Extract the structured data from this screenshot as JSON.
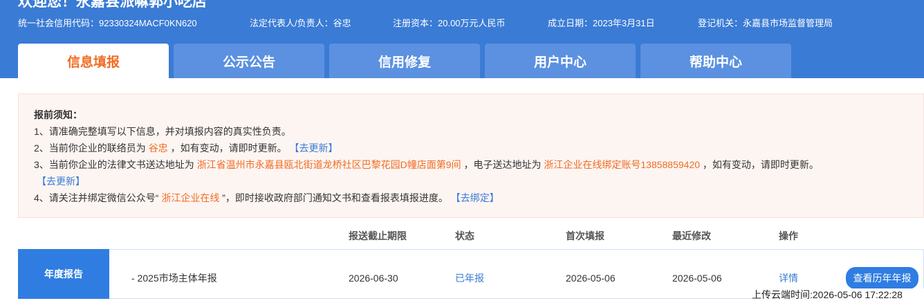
{
  "header": {
    "company_title": "欢迎您！永嘉县派嘛郭小吃店",
    "credit_code": "统一社会信用代码：92330324MACF0KN620",
    "legal_rep": "法定代表人/负责人：谷忠",
    "capital": "注册资本：20.00万元人民币",
    "established": "成立日期：2023年3月31日",
    "authority": "登记机关：永嘉县市场监督管理局"
  },
  "tabs": [
    {
      "label": "信息填报",
      "active": true
    },
    {
      "label": "公示公告",
      "active": false
    },
    {
      "label": "信用修复",
      "active": false
    },
    {
      "label": "用户中心",
      "active": false
    },
    {
      "label": "帮助中心",
      "active": false
    }
  ],
  "notice": {
    "title": "报前须知：",
    "line1": "1、请准确完整填写以下信息，并对填报内容的真实性负责。",
    "line2_prefix": "2、当前你企业的联络员为",
    "line2_contact": "谷忠",
    "line2_mid": "，如有变动，请即时更新。",
    "line2_link": "【去更新】",
    "line3_prefix": "3、当前你企业的法律文书送达地址为",
    "line3_address": "浙江省温州市永嘉县瓯北街道龙桥社区巴黎花园D幢店面第9间",
    "line3_mid": "，电子送达地址为",
    "line3_email": "浙江企业在线绑定账号13858859420",
    "line3_suffix": "，如有变动，请即时更新。",
    "line3_link": "【去更新】",
    "line4_prefix": "4、请关注并绑定微信公众号“",
    "line4_account": "浙江企业在线",
    "line4_mid": "”，即时接收政府部门通知文书和查看报表填报进度。",
    "line4_link": "【去绑定】"
  },
  "table": {
    "columns": [
      "报送截止期限",
      "状态",
      "首次填报",
      "最近修改",
      "操作"
    ],
    "row_label": "年度报告",
    "row": {
      "name": "- 2025市场主体年报",
      "deadline": "2026-06-30",
      "status": "已年报",
      "first_filed": "2026-05-06",
      "last_modified": "2026-05-06",
      "action": "详情"
    },
    "history_button": "查看历年年报"
  },
  "upload_time": "上传云端时间:2026-05-06 17:22:28",
  "colors": {
    "brand_blue": "#3a7bd5",
    "tab_blue": "#5b91e0",
    "accent_orange": "#f06c23",
    "notice_bg": "#fdf5f2"
  }
}
